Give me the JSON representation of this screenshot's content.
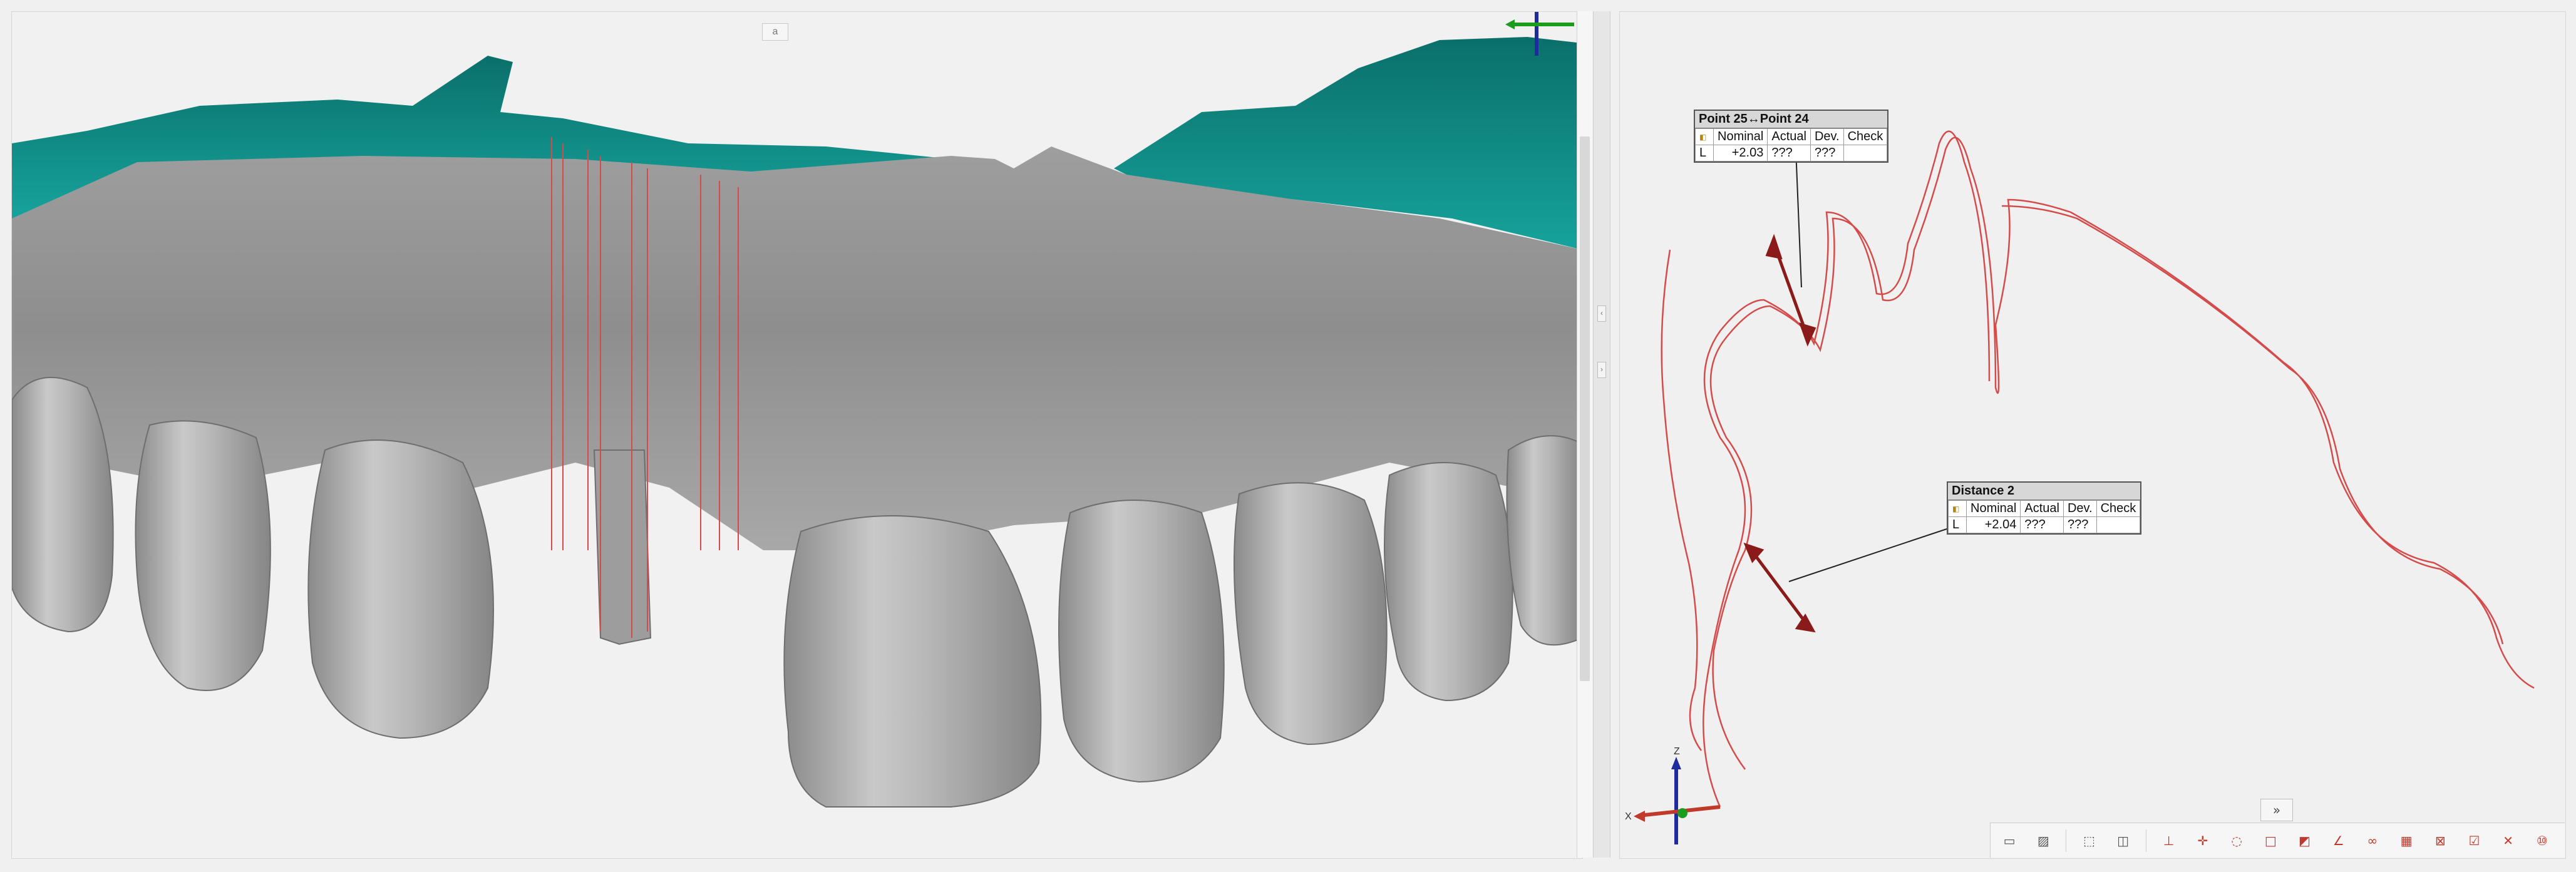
{
  "viewport3d": {
    "top_tab_label": "a"
  },
  "measurements": [
    {
      "title": "Point 25↔Point 24",
      "icon": "measurement-icon",
      "headers": [
        "",
        "Nominal",
        "Actual",
        "Dev.",
        "Check"
      ],
      "row": [
        "L",
        "+2.03",
        "???",
        "???",
        ""
      ]
    },
    {
      "title": "Distance 2",
      "icon": "measurement-icon",
      "headers": [
        "",
        "Nominal",
        "Actual",
        "Dev.",
        "Check"
      ],
      "row": [
        "L",
        "+2.04",
        "???",
        "???",
        ""
      ]
    }
  ],
  "axis_labels": {
    "x": "X",
    "z": "Z"
  },
  "expand_button_label": "»",
  "toolbar_icons": [
    "view-mode-icon",
    "hatch-icon",
    "select-icon",
    "split-icon",
    "align-icon",
    "point-icon",
    "circle-icon",
    "rectangle-icon",
    "plane-icon",
    "angle-icon",
    "link-icon",
    "grid-icon",
    "intersect-icon",
    "report-icon",
    "close-icon",
    "numbering-icon"
  ],
  "colors": {
    "teal_gum": "#0e8c86",
    "tooth_gray": "#b5b5b5",
    "section_line": "#d44b4b",
    "toolbar_red": "#c0392b"
  }
}
